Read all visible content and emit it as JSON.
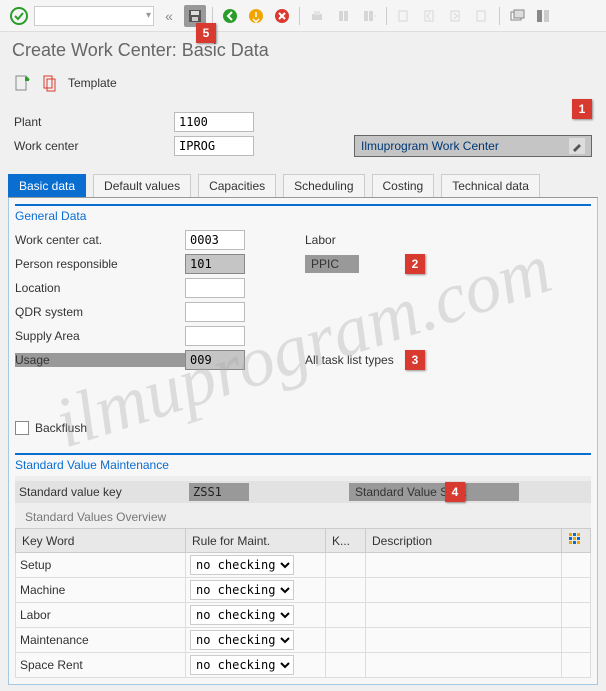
{
  "toolbar": {
    "check": "check-icon",
    "combo_value": "",
    "save": "save-icon"
  },
  "callouts": [
    "1",
    "2",
    "3",
    "4",
    "5"
  ],
  "title": "Create Work Center: Basic Data",
  "template_btn": "Template",
  "header": {
    "plant_label": "Plant",
    "plant_value": "1100",
    "wc_label": "Work center",
    "wc_value": "IPROG",
    "desc_value": "Ilmuprogram Work Center"
  },
  "tabs": [
    "Basic data",
    "Default values",
    "Capacities",
    "Scheduling",
    "Costing",
    "Technical data"
  ],
  "active_tab": 0,
  "general": {
    "title": "General Data",
    "rows": {
      "cat_label": "Work center cat.",
      "cat_value": "0003",
      "cat_desc": "Labor",
      "resp_label": "Person responsible",
      "resp_value": "101",
      "resp_desc": "PPIC",
      "loc_label": "Location",
      "loc_value": "",
      "qdr_label": "QDR system",
      "qdr_value": "",
      "supply_label": "Supply Area",
      "supply_value": "",
      "usage_label": "Usage",
      "usage_value": "009",
      "usage_desc": "All task list types"
    }
  },
  "backflush_label": "Backflush",
  "svm": {
    "group_title": "Standard Value Maintenance",
    "key_label": "Standard value key",
    "key_value": "ZSS1",
    "key_desc": "Standard Value SS 1",
    "overview_title": "Standard Values Overview",
    "columns": [
      "Key Word",
      "Rule for Maint.",
      "K...",
      "Description"
    ],
    "rule_options": [
      "no checking"
    ],
    "rows": [
      {
        "key": "Setup",
        "rule": "no checking",
        "k": "",
        "desc": ""
      },
      {
        "key": "Machine",
        "rule": "no checking",
        "k": "",
        "desc": ""
      },
      {
        "key": "Labor",
        "rule": "no checking",
        "k": "",
        "desc": ""
      },
      {
        "key": "Maintenance",
        "rule": "no checking",
        "k": "",
        "desc": ""
      },
      {
        "key": "Space Rent",
        "rule": "no checking",
        "k": "",
        "desc": ""
      }
    ]
  },
  "watermark": "ilmuprogram.com"
}
